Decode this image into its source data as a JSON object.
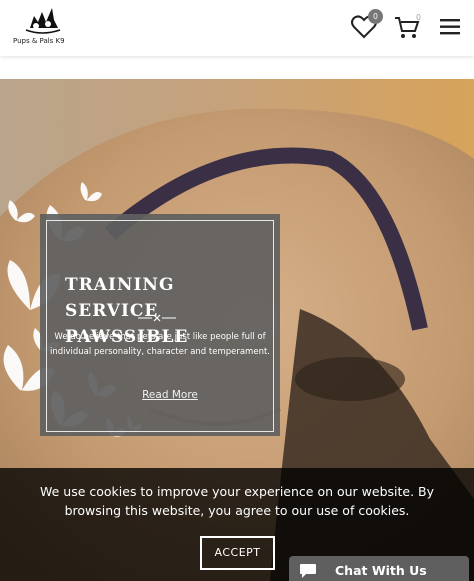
{
  "brand": {
    "name": "Pups & Pals K9"
  },
  "header": {
    "wishlist_count": "0",
    "cart_count": "0",
    "icons": [
      "heart-icon",
      "cart-icon",
      "hamburger-menu-icon"
    ]
  },
  "hero": {
    "title": "TRAINING SERVICE PAWSSIBLE",
    "description": "We do believe that pets are just like people full of individual personality, character and temperament.",
    "link_label": "Read More"
  },
  "cookie_banner": {
    "message": "We use cookies to improve your experience on our website. By browsing this website, you agree to our use of cookies.",
    "accept_label": "ACCEPT"
  },
  "chat_widget": {
    "label": "Chat With Us"
  },
  "colors": {
    "card_bg": "#606060",
    "banner_bg": "#000000",
    "chat_bg": "#5f5f5f",
    "badge": "#777777"
  }
}
